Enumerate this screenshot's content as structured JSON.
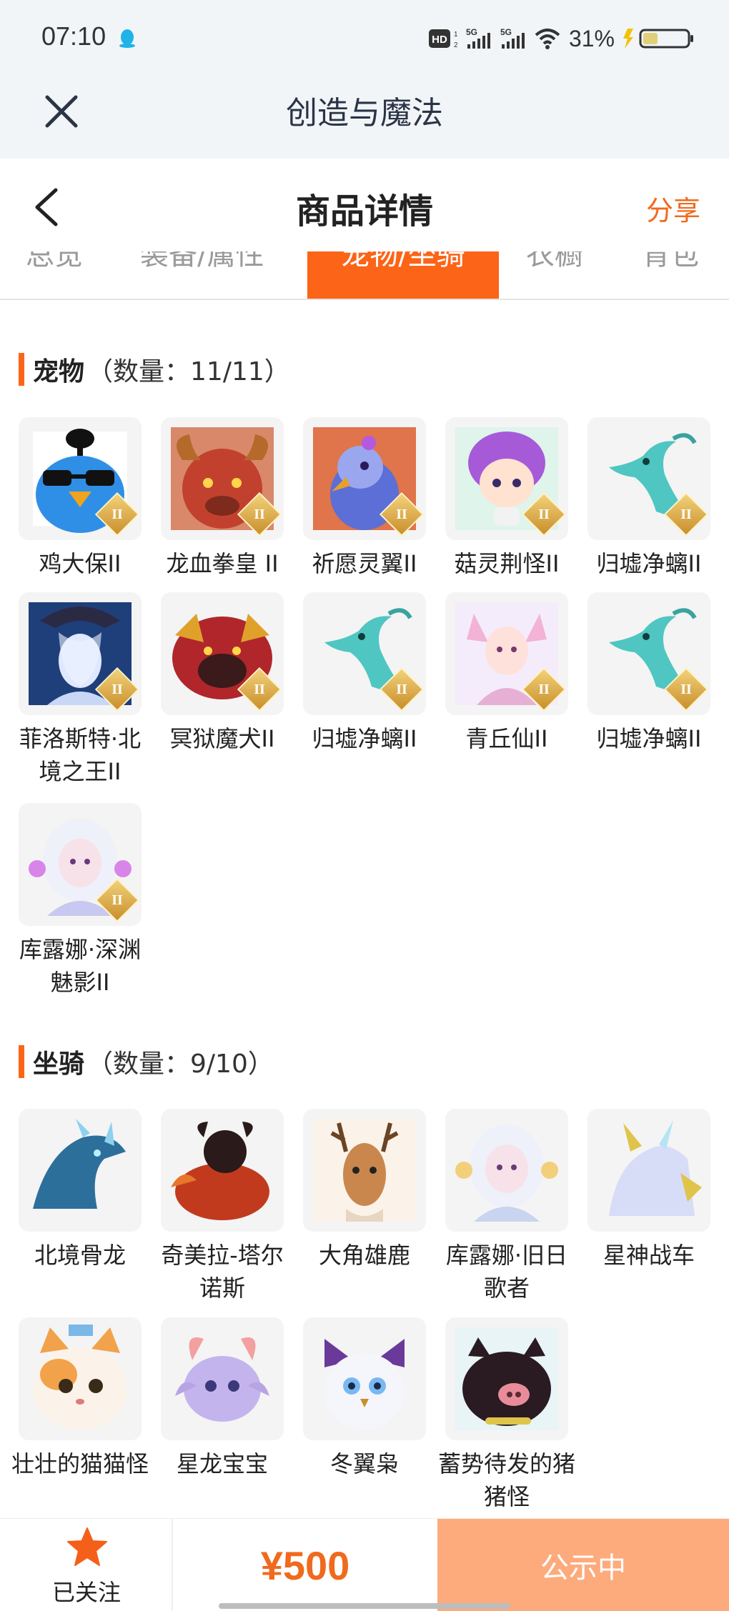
{
  "status_bar": {
    "time": "07:10",
    "battery_percent": "31%"
  },
  "app_header": {
    "title": "创造与魔法"
  },
  "nav": {
    "title": "商品详情",
    "share_label": "分享"
  },
  "tabs": [
    {
      "label": "总览"
    },
    {
      "label": "装备/属性"
    },
    {
      "label": "宠物/坐骑",
      "active": true
    },
    {
      "label": "衣橱"
    },
    {
      "label": "背包"
    }
  ],
  "pets": {
    "title": "宠物",
    "count": "（数量：11/11）",
    "items": [
      {
        "name": "鸡大保II",
        "badge": "II",
        "icon": "blue-bird-sunglasses"
      },
      {
        "name": "龙血拳皇 II",
        "badge": "II",
        "icon": "red-horned-beast"
      },
      {
        "name": "祈愿灵翼II",
        "badge": "II",
        "icon": "purple-griffin"
      },
      {
        "name": "菇灵荆怪II",
        "badge": "II",
        "icon": "purple-hair-sprite"
      },
      {
        "name": "归墟净螭II",
        "badge": "II",
        "icon": "cyan-dragon"
      },
      {
        "name": "菲洛斯特·北境之王II",
        "badge": "II",
        "icon": "frost-king"
      },
      {
        "name": "冥狱魔犬II",
        "badge": "II",
        "icon": "hell-hound"
      },
      {
        "name": "归墟净螭II",
        "badge": "II",
        "icon": "cyan-dragon"
      },
      {
        "name": "青丘仙II",
        "badge": "II",
        "icon": "fox-fairy"
      },
      {
        "name": "归墟净螭II",
        "badge": "II",
        "icon": "cyan-dragon"
      },
      {
        "name": "库露娜·深渊魅影II",
        "badge": "II",
        "icon": "white-hair-girl"
      }
    ]
  },
  "mounts": {
    "title": "坐骑",
    "count": "（数量：9/10）",
    "items": [
      {
        "name": "北境骨龙",
        "icon": "ice-bone-dragon"
      },
      {
        "name": "奇美拉-塔尔诺斯",
        "icon": "chimera"
      },
      {
        "name": "大角雄鹿",
        "icon": "stag"
      },
      {
        "name": "库露娜·旧日歌者",
        "icon": "white-hair-singer"
      },
      {
        "name": "星神战车",
        "icon": "crystal-horse"
      },
      {
        "name": "壮壮的猫猫怪",
        "icon": "calico-cat"
      },
      {
        "name": "星龙宝宝",
        "icon": "baby-star-dragon"
      },
      {
        "name": "冬翼枭",
        "icon": "winter-owl"
      },
      {
        "name": "蓄势待发的猪猪怪",
        "icon": "black-pig"
      }
    ]
  },
  "bottom_bar": {
    "follow_label": "已关注",
    "price": "¥500",
    "status_button": "公示中"
  },
  "colors": {
    "accent": "#fc6418",
    "cta_bg": "#fdab7c",
    "badge_gold": "#d9a441"
  }
}
